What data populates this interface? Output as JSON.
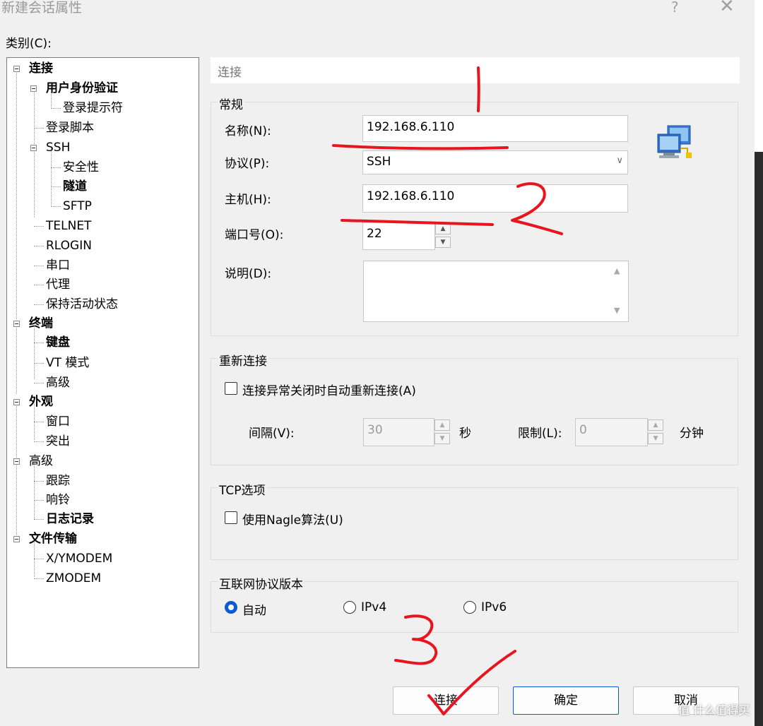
{
  "window": {
    "title": "新建会话属性",
    "help_label": "?",
    "close_label": "✕"
  },
  "category_label": "类别(C):",
  "tree": [
    {
      "label": "连接",
      "bold": true
    },
    {
      "label": "用户身份验证",
      "bold": true
    },
    {
      "label": "登录提示符",
      "bold": false
    },
    {
      "label": "登录脚本",
      "bold": false
    },
    {
      "label": "SSH",
      "bold": false
    },
    {
      "label": "安全性",
      "bold": false
    },
    {
      "label": "隧道",
      "bold": true
    },
    {
      "label": "SFTP",
      "bold": false
    },
    {
      "label": "TELNET",
      "bold": false
    },
    {
      "label": "RLOGIN",
      "bold": false
    },
    {
      "label": "串口",
      "bold": false
    },
    {
      "label": "代理",
      "bold": false
    },
    {
      "label": "保持活动状态",
      "bold": false
    },
    {
      "label": "终端",
      "bold": true
    },
    {
      "label": "键盘",
      "bold": true
    },
    {
      "label": "VT 模式",
      "bold": false
    },
    {
      "label": "高级",
      "bold": false
    },
    {
      "label": "外观",
      "bold": true
    },
    {
      "label": "窗口",
      "bold": false
    },
    {
      "label": "突出",
      "bold": false
    },
    {
      "label": "高级",
      "bold": false
    },
    {
      "label": "跟踪",
      "bold": false
    },
    {
      "label": "响铃",
      "bold": false
    },
    {
      "label": "日志记录",
      "bold": true
    },
    {
      "label": "文件传输",
      "bold": true
    },
    {
      "label": "X/YMODEM",
      "bold": false
    },
    {
      "label": "ZMODEM",
      "bold": false
    }
  ],
  "breadcrumb": "连接",
  "general": {
    "title": "常规",
    "name_label": "名称(N):",
    "name_value": "192.168.6.110",
    "protocol_label": "协议(P):",
    "protocol_value": "SSH",
    "host_label": "主机(H):",
    "host_value": "192.168.6.110",
    "port_label": "端口号(O):",
    "port_value": "22",
    "desc_label": "说明(D):",
    "desc_value": ""
  },
  "reconnect": {
    "title": "重新连接",
    "auto_label": "连接异常关闭时自动重新连接(A)",
    "auto_checked": false,
    "interval_label": "间隔(V):",
    "interval_value": "30",
    "interval_unit": "秒",
    "limit_label": "限制(L):",
    "limit_value": "0",
    "limit_unit": "分钟"
  },
  "tcp": {
    "title": "TCP选项",
    "nagle_label": "使用Nagle算法(U)",
    "nagle_checked": false
  },
  "ipversion": {
    "title": "互联网协议版本",
    "options": [
      "自动",
      "IPv4",
      "IPv6"
    ],
    "selected": "自动"
  },
  "buttons": {
    "connect": "连接",
    "ok": "确定",
    "cancel": "取消"
  },
  "watermark": "值 什么值得买",
  "colors": {
    "accent": "#0a5bd6",
    "annotation": "#e8141e"
  }
}
